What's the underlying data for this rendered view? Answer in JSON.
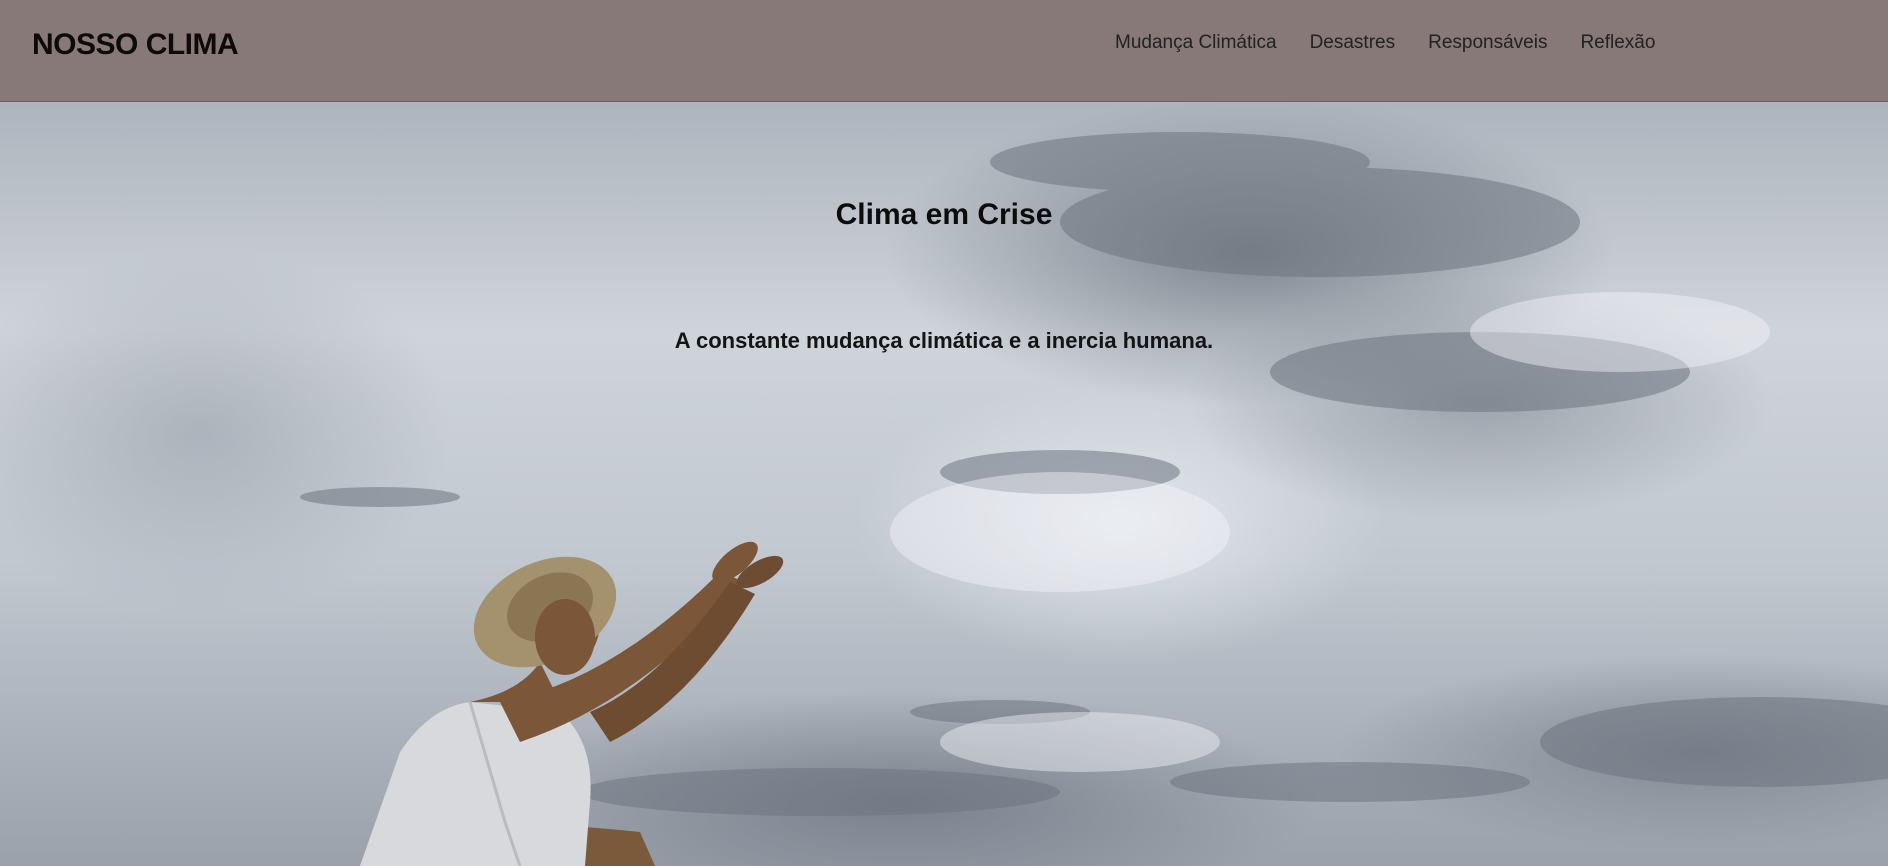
{
  "header": {
    "logo": "NOSSO CLIMA",
    "nav": [
      {
        "label": "Mudança Climática"
      },
      {
        "label": "Desastres"
      },
      {
        "label": "Responsáveis"
      },
      {
        "label": "Reflexão"
      }
    ]
  },
  "hero": {
    "title": "Clima em Crise",
    "subtitle": "A constante mudança climática e a inercia humana.",
    "image": "woman-raising-hands-to-cloudy-sky"
  },
  "colors": {
    "header_bg": "#877978",
    "text": "#0d0a0a",
    "sky": "#c7ccd3"
  }
}
